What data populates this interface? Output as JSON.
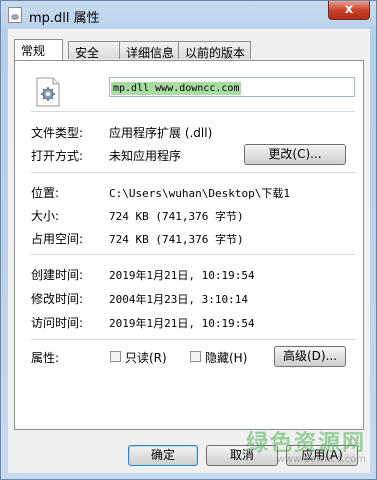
{
  "window": {
    "title": "mp.dll 属性",
    "close_label": "x"
  },
  "tabs": [
    {
      "label": "常规",
      "active": true
    },
    {
      "label": "安全",
      "active": false
    },
    {
      "label": "详细信息",
      "active": false
    },
    {
      "label": "以前的版本",
      "active": false
    }
  ],
  "file": {
    "name_value": "mp.dll www.downcc.com",
    "icon": "dll-gear-file-icon"
  },
  "props": {
    "type_label": "文件类型:",
    "type_value": "应用程序扩展 (.dll)",
    "open_label": "打开方式:",
    "open_value": "未知应用程序",
    "change_button": "更改(C)...",
    "location_label": "位置:",
    "location_value": "C:\\Users\\wuhan\\Desktop\\下载1",
    "size_label": "大小:",
    "size_value": "724 KB (741,376 字节)",
    "disk_label": "占用空间:",
    "disk_value": "724 KB (741,376 字节)",
    "created_label": "创建时间:",
    "created_value": "2019年1月21日, 10:19:54",
    "modified_label": "修改时间:",
    "modified_value": "2004年1月23日, 3:10:14",
    "accessed_label": "访问时间:",
    "accessed_value": "2019年1月21日, 10:19:54",
    "attrs_label": "属性:",
    "readonly_label": "只读(R)",
    "readonly_checked": false,
    "hidden_label": "隐藏(H)",
    "hidden_checked": false,
    "advanced_button": "高级(D)..."
  },
  "footer": {
    "ok": "确定",
    "cancel": "取消",
    "apply": "应用(A)"
  },
  "watermark": {
    "text": "绿色资源网",
    "url": "www.downcc.com"
  }
}
